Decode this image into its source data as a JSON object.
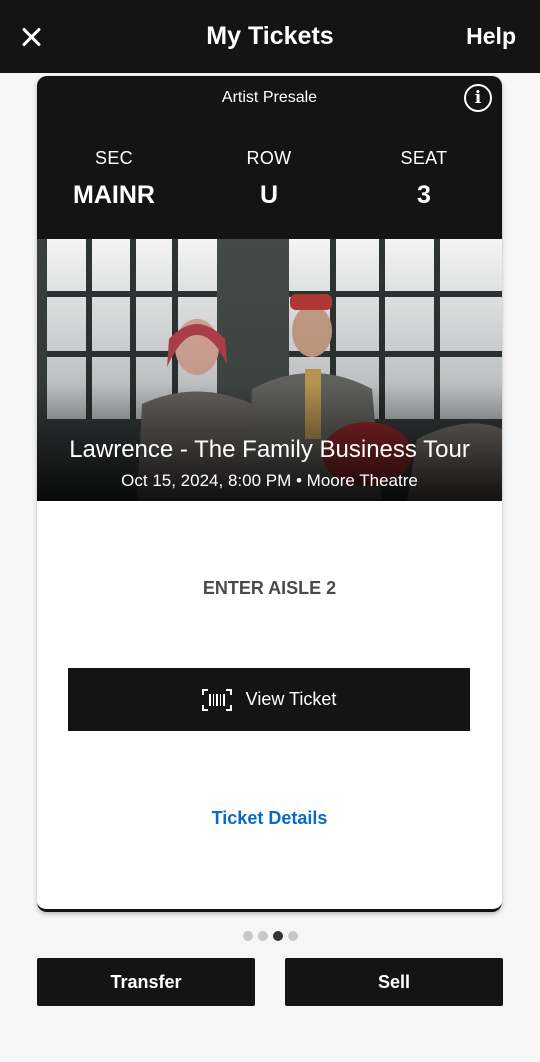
{
  "header": {
    "title": "My Tickets",
    "help_label": "Help"
  },
  "ticket": {
    "presale_label": "Artist Presale",
    "info_icon_glyph": "i",
    "section_label": "SEC",
    "section_value": "MAINR",
    "row_label": "ROW",
    "row_value": "U",
    "seat_label": "SEAT",
    "seat_value": "3",
    "event_name": "Lawrence - The Family Business Tour",
    "event_datetime_venue": "Oct 15, 2024, 8:00 PM • Moore Theatre",
    "entrance_note": "ENTER AISLE 2",
    "view_ticket_label": "View Ticket",
    "details_link": "Ticket Details"
  },
  "pager": {
    "total": 4,
    "active_index": 2
  },
  "actions": {
    "transfer_label": "Transfer",
    "sell_label": "Sell"
  },
  "colors": {
    "bar_bg": "#141414",
    "link_blue": "#0a6ac8",
    "page_bg": "#f6f6f6"
  }
}
